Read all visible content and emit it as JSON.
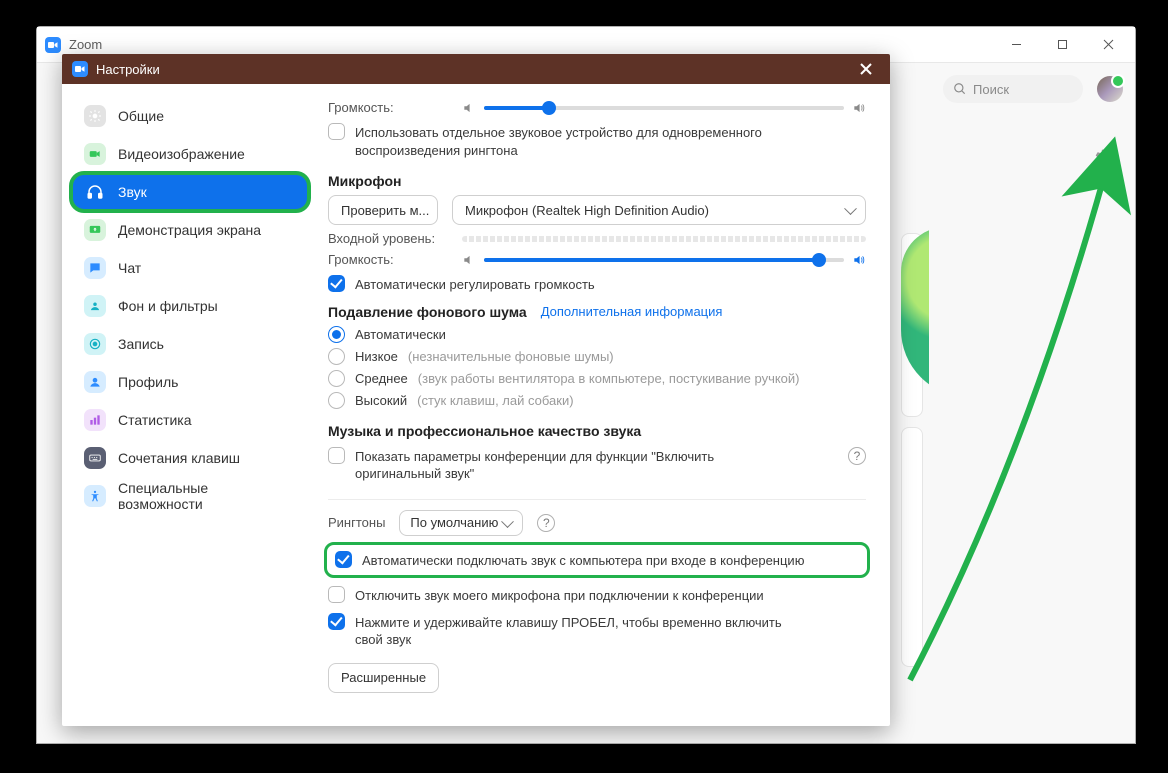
{
  "window": {
    "title": "Zoom"
  },
  "search": {
    "placeholder": "Поиск"
  },
  "modal": {
    "title": "Настройки"
  },
  "sidebar": {
    "items": [
      {
        "label": "Общие"
      },
      {
        "label": "Видеоизображение"
      },
      {
        "label": "Звук"
      },
      {
        "label": "Демонстрация экрана"
      },
      {
        "label": "Чат"
      },
      {
        "label": "Фон и фильтры"
      },
      {
        "label": "Запись"
      },
      {
        "label": "Профиль"
      },
      {
        "label": "Статистика"
      },
      {
        "label": "Сочетания клавиш"
      },
      {
        "label": "Специальные возможности"
      }
    ]
  },
  "audio": {
    "volume_label": "Громкость:",
    "speaker_level_pct": 18,
    "separate_device": "Использовать отдельное звуковое устройство для одновременного воспроизведения рингтона",
    "mic_title": "Микрофон",
    "test_mic_btn": "Проверить м...",
    "mic_device": "Микрофон (Realtek High Definition Audio)",
    "input_level_label": "Входной уровень:",
    "mic_volume_label": "Громкость:",
    "mic_level_pct": 93,
    "auto_adjust": "Автоматически регулировать громкость",
    "noise_title": "Подавление фонового шума",
    "noise_link": "Дополнительная информация",
    "noise_opts": [
      {
        "label": "Автоматически",
        "hint": ""
      },
      {
        "label": "Низкое",
        "hint": "(незначительные фоновые шумы)"
      },
      {
        "label": "Среднее",
        "hint": "(звук работы вентилятора в компьютере, постукивание ручкой)"
      },
      {
        "label": "Высокий",
        "hint": "(стук клавиш, лай собаки)"
      }
    ],
    "music_title": "Музыка и профессиональное качество звука",
    "show_original": "Показать параметры конференции для функции \"Включить оригинальный звук\"",
    "ringtones_label": "Рингтоны",
    "ringtone_value": "По умолчанию",
    "auto_join_audio": "Автоматически подключать звук с компьютера при входе в конференцию",
    "mute_mic_join": "Отключить звук моего микрофона при подключении к конференции",
    "hold_space": "Нажмите и удерживайте клавишу ПРОБЕЛ, чтобы временно включить свой звук",
    "advanced_btn": "Расширенные"
  }
}
